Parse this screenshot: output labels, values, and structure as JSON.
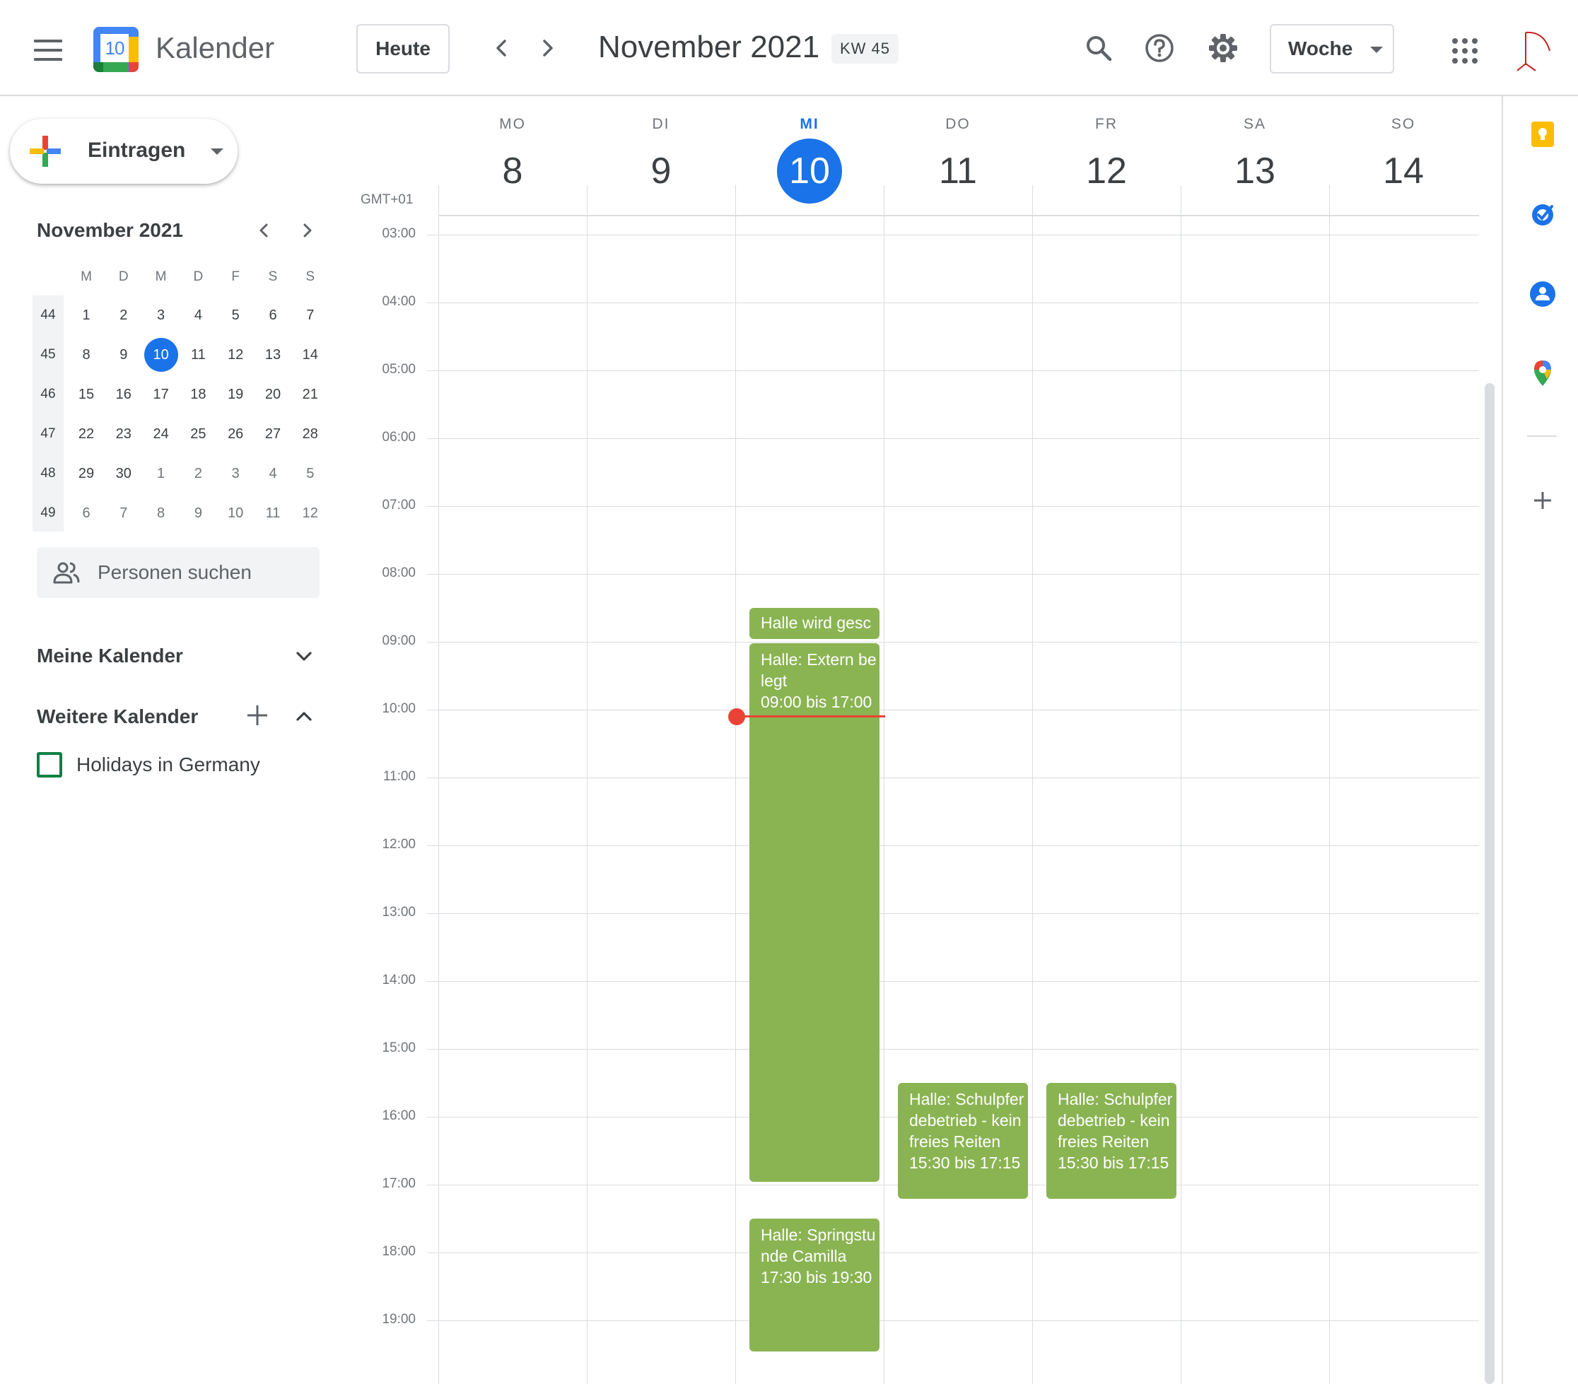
{
  "header": {
    "app_title": "Kalender",
    "logo_day": "10",
    "today_label": "Heute",
    "month_title": "November 2021",
    "week_badge": "KW 45",
    "view_select": "Woche",
    "icons": [
      "menu-icon",
      "chevron-left-icon",
      "chevron-right-icon",
      "search-icon",
      "help-icon",
      "settings-icon",
      "apps-icon",
      "account-icon"
    ]
  },
  "sidebar": {
    "create_label": "Eintragen",
    "mini_calendar": {
      "title": "November 2021",
      "weekdays": [
        "M",
        "D",
        "M",
        "D",
        "F",
        "S",
        "S"
      ],
      "weeks": [
        {
          "kw": "44",
          "days": [
            "1",
            "2",
            "3",
            "4",
            "5",
            "6",
            "7"
          ]
        },
        {
          "kw": "45",
          "days": [
            "8",
            "9",
            "10",
            "11",
            "12",
            "13",
            "14"
          ]
        },
        {
          "kw": "46",
          "days": [
            "15",
            "16",
            "17",
            "18",
            "19",
            "20",
            "21"
          ]
        },
        {
          "kw": "47",
          "days": [
            "22",
            "23",
            "24",
            "25",
            "26",
            "27",
            "28"
          ]
        },
        {
          "kw": "48",
          "days": [
            "29",
            "30",
            "1",
            "2",
            "3",
            "4",
            "5"
          ]
        },
        {
          "kw": "49",
          "days": [
            "6",
            "7",
            "8",
            "9",
            "10",
            "11",
            "12"
          ]
        }
      ],
      "today": "10"
    },
    "people_search_placeholder": "Personen suchen",
    "my_calendars_title": "Meine Kalender",
    "other_calendars_title": "Weitere Kalender",
    "other_calendars": [
      {
        "name": "Holidays in Germany",
        "color": "#0b8043",
        "checked": false
      }
    ]
  },
  "week": {
    "timezone": "GMT+01",
    "days": [
      {
        "dow": "MO",
        "num": "8"
      },
      {
        "dow": "DI",
        "num": "9"
      },
      {
        "dow": "MI",
        "num": "10",
        "today": true
      },
      {
        "dow": "DO",
        "num": "11"
      },
      {
        "dow": "FR",
        "num": "12"
      },
      {
        "dow": "SA",
        "num": "13"
      },
      {
        "dow": "SO",
        "num": "14"
      }
    ],
    "hours": [
      "03:00",
      "04:00",
      "05:00",
      "06:00",
      "07:00",
      "08:00",
      "09:00",
      "10:00",
      "11:00",
      "12:00",
      "13:00",
      "14:00",
      "15:00",
      "16:00",
      "17:00",
      "18:00",
      "19:00"
    ],
    "events": [
      {
        "day": "MI",
        "title": "Halle wird gesc",
        "time": ""
      },
      {
        "day": "MI",
        "title": "Halle: Extern belegt",
        "time": "09:00 bis 17:00"
      },
      {
        "day": "DO",
        "title": "Halle: Schulpferdebetrieb - kein freies Reiten",
        "time": "15:30 bis 17:15"
      },
      {
        "day": "FR",
        "title": "Halle: Schulpferdebetrieb - kein freies Reiten",
        "time": "15:30 bis 17:15"
      },
      {
        "day": "MI",
        "title": "Halle: Springstunde Camilla",
        "time": "17:30 bis 19:30"
      }
    ],
    "event_color": "#8ab452",
    "now_indicator_color": "#ea4335"
  },
  "right_rail": {
    "icons": [
      "keep-icon",
      "tasks-icon",
      "contacts-icon",
      "maps-icon",
      "add-addon-icon"
    ]
  },
  "colors": {
    "accent": "#1a73e8",
    "event": "#8ab452",
    "now": "#ea4335"
  }
}
